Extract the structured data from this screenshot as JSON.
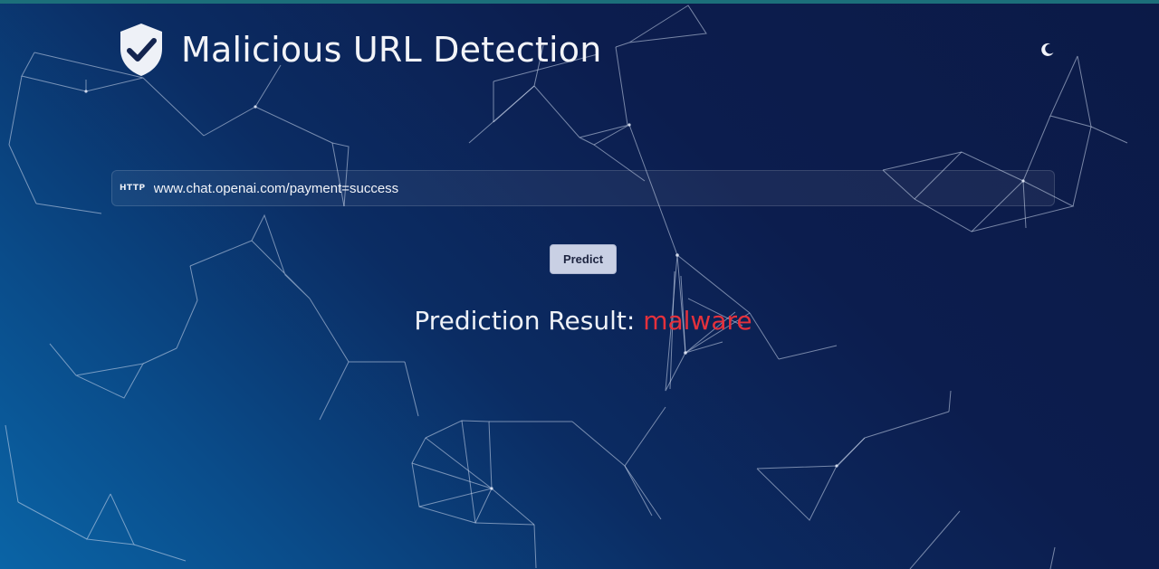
{
  "header": {
    "title": "Malicious URL Detection",
    "logo_icon": "shield-check-icon",
    "theme_toggle_icon": "moon-icon"
  },
  "search": {
    "prefix_label": "HTTP",
    "value": "www.chat.openai.com/payment=success",
    "placeholder": ""
  },
  "actions": {
    "predict_label": "Predict"
  },
  "result": {
    "label": "Prediction Result:",
    "verdict": "malware",
    "verdict_color": "#e5313c"
  },
  "colors": {
    "background_dark": "#0b1a47",
    "background_light": "#0a64a6",
    "button_bg": "#c9d0e4",
    "top_strip": "#1c6f7a"
  }
}
